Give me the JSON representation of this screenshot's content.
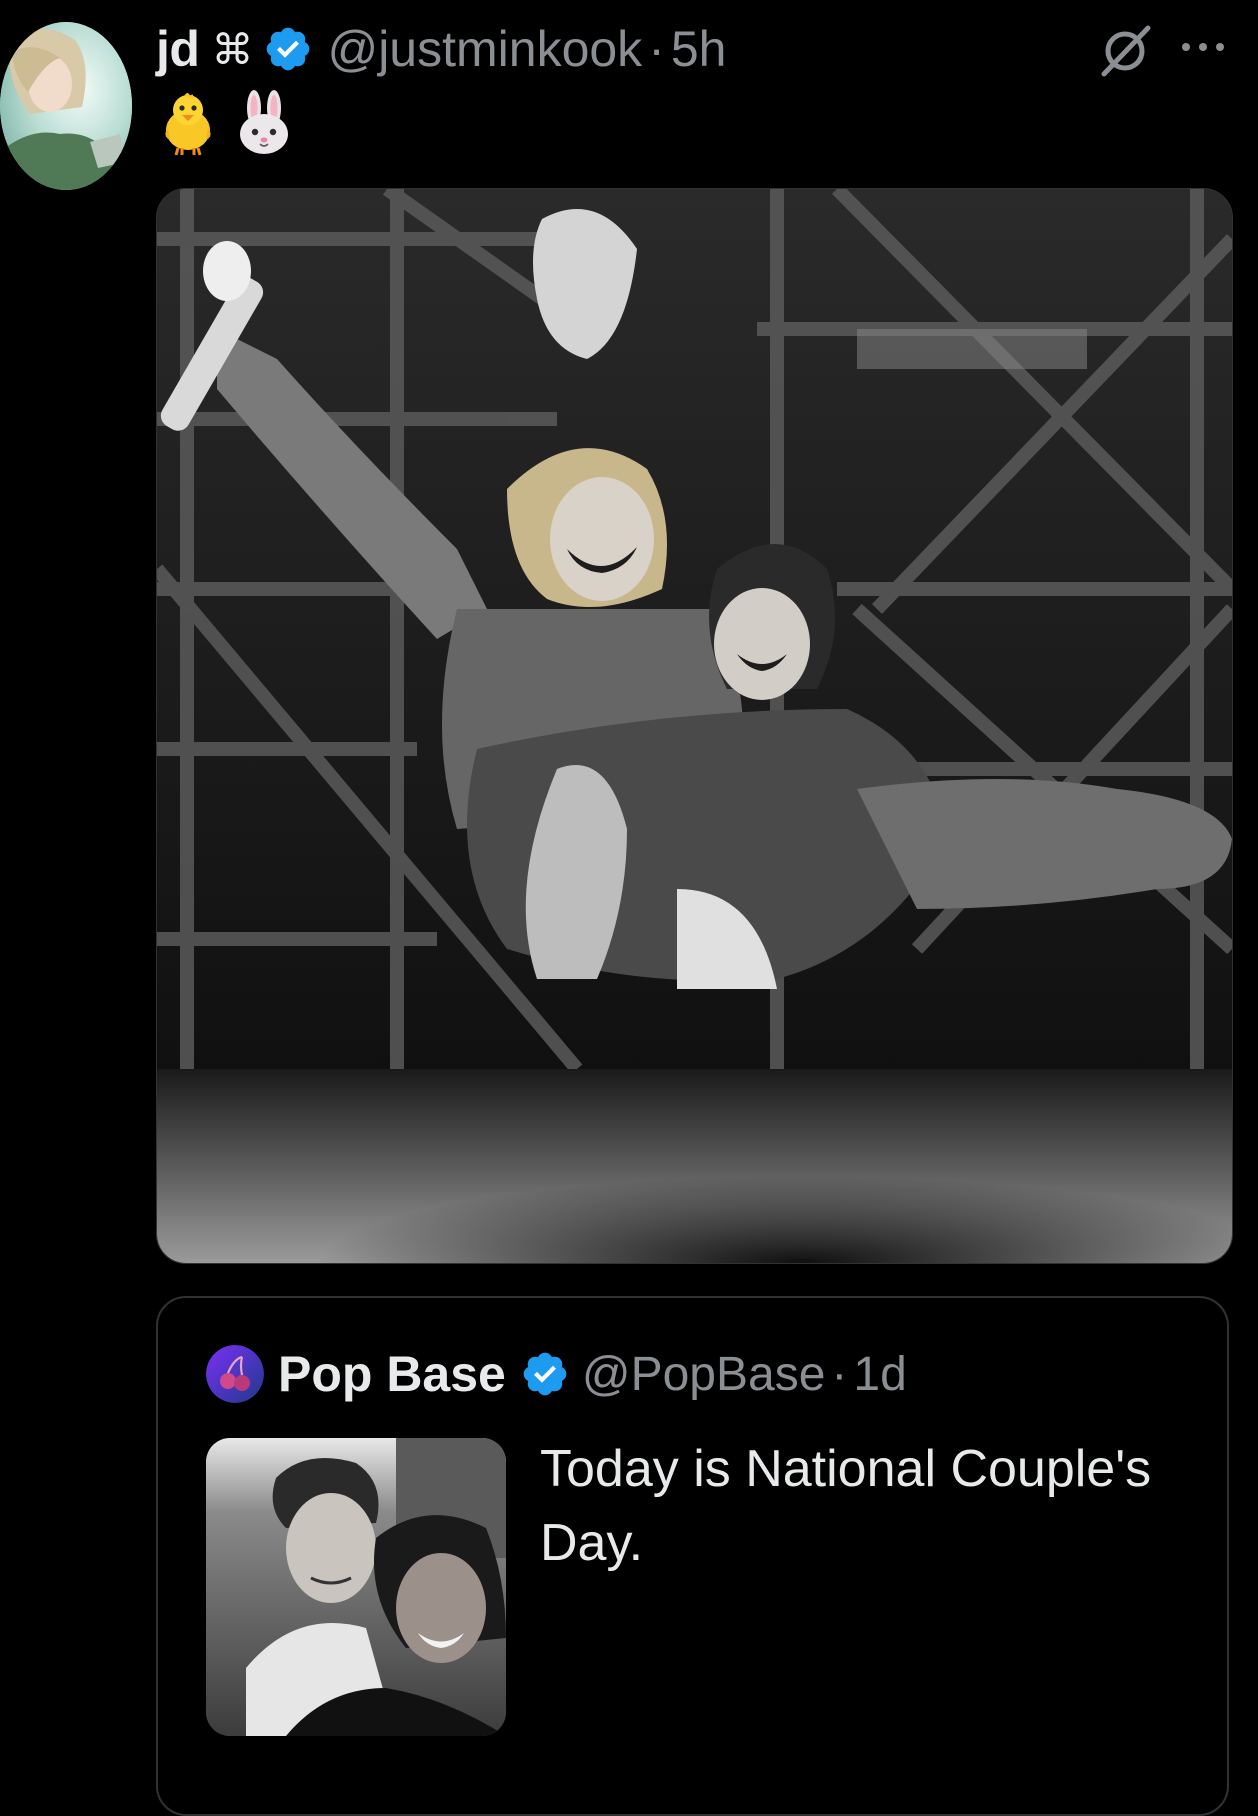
{
  "post": {
    "display_name": "jd",
    "name_glyph": "⌘",
    "handle": "@justminkook",
    "separator": "·",
    "time": "5h",
    "emojis": [
      "chick-emoji",
      "rabbit-face-emoji"
    ],
    "media": {
      "description_icon": "photo",
      "style": "black-and-white concert photo"
    }
  },
  "quoted_post": {
    "display_name": "Pop Base",
    "handle": "@PopBase",
    "separator": "·",
    "time": "1d",
    "text": "Today is National Couple's Day."
  },
  "icons": {
    "verified": "verified-badge-icon",
    "grok": "grok-icon",
    "more": "more-options-icon"
  },
  "colors": {
    "background": "#000000",
    "text_primary": "#e7e9ea",
    "text_secondary": "#8b8f94",
    "verified_blue": "#1d9bf0",
    "border": "#2f3336"
  }
}
